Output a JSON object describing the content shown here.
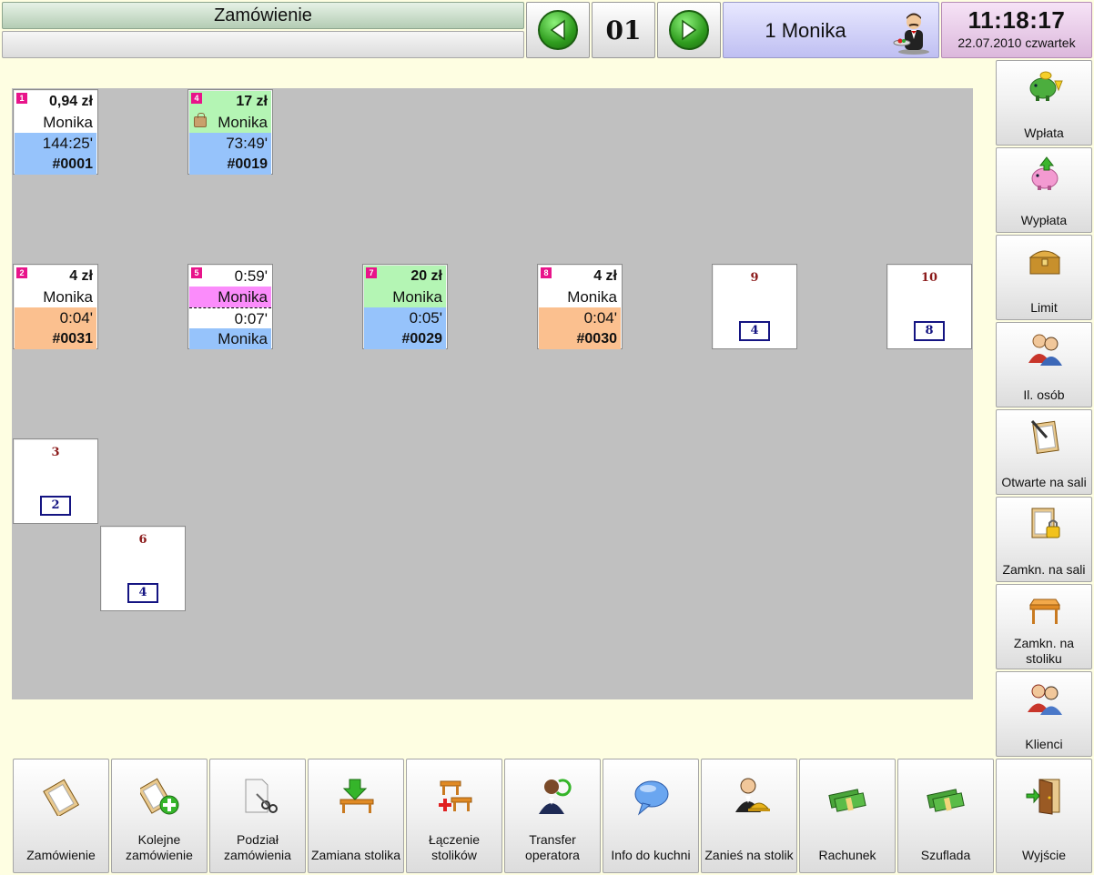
{
  "header": {
    "title": "Zamówienie",
    "table_number": "01",
    "operator": "1 Monika",
    "time": "11:18:17",
    "date": "22.07.2010 czwartek"
  },
  "floor": {
    "occupied": [
      {
        "id": "1",
        "r1": "0,94 zł",
        "r2": "Monika",
        "r3": "144:25'",
        "r4": "#0001"
      },
      {
        "id": "4",
        "r1": "17 zł",
        "r2": "Monika",
        "r3": "73:49'",
        "r4": "#0019"
      },
      {
        "id": "2",
        "r1": "4 zł",
        "r2": "Monika",
        "r3": "0:04'",
        "r4": "#0031"
      },
      {
        "id": "5",
        "r1": "0:59'",
        "r2": "Monika",
        "r3": "0:07'",
        "r4": "Monika"
      },
      {
        "id": "7",
        "r1": "20 zł",
        "r2": "Monika",
        "r3": "0:05'",
        "r4": "#0029"
      },
      {
        "id": "8",
        "r1": "4 zł",
        "r2": "Monika",
        "r3": "0:04'",
        "r4": "#0030"
      }
    ],
    "free": [
      {
        "id": "9",
        "seats": "4"
      },
      {
        "id": "10",
        "seats": "8"
      },
      {
        "id": "3",
        "seats": "2"
      },
      {
        "id": "6",
        "seats": "4"
      }
    ]
  },
  "side_buttons": [
    {
      "label": "Wpłata",
      "icon": "piggy-bank-in-icon"
    },
    {
      "label": "Wypłata",
      "icon": "piggy-bank-out-icon"
    },
    {
      "label": "Limit",
      "icon": "treasure-chest-icon"
    },
    {
      "label": "Il. osób",
      "icon": "people-icon"
    },
    {
      "label": "Otwarte na sali",
      "icon": "clipboard-pen-icon"
    },
    {
      "label": "Zamkn. na sali",
      "icon": "clipboard-lock-icon"
    },
    {
      "label": "Zamkn. na stoliku",
      "icon": "table-icon"
    },
    {
      "label": "Klienci",
      "icon": "clients-icon"
    }
  ],
  "bottom_buttons": [
    {
      "label": "Zamówienie",
      "icon": "clipboard-icon"
    },
    {
      "label": "Kolejne zamówienie",
      "icon": "clipboard-add-icon"
    },
    {
      "label": "Podział zamówienia",
      "icon": "scissors-icon"
    },
    {
      "label": "Zamiana stolika",
      "icon": "table-swap-icon"
    },
    {
      "label": "Łączenie stolików",
      "icon": "table-join-icon"
    },
    {
      "label": "Transfer operatora",
      "icon": "operator-transfer-icon"
    },
    {
      "label": "Info do kuchni",
      "icon": "speech-bubble-icon"
    },
    {
      "label": "Zanieś na stolik",
      "icon": "waiter-icon"
    },
    {
      "label": "Rachunek",
      "icon": "money-icon"
    },
    {
      "label": "Szuflada",
      "icon": "money-drawer-icon"
    },
    {
      "label": "Wyjście",
      "icon": "exit-door-icon"
    }
  ],
  "colors": {
    "background": "#fefee2",
    "floor": "#c0c0c0",
    "amount_green": "#b4f5b4",
    "time_blue": "#96c3fb",
    "time_orange": "#fbc08f",
    "operator_pink": "#fb8cfb",
    "table_badge": "#e8148a"
  }
}
